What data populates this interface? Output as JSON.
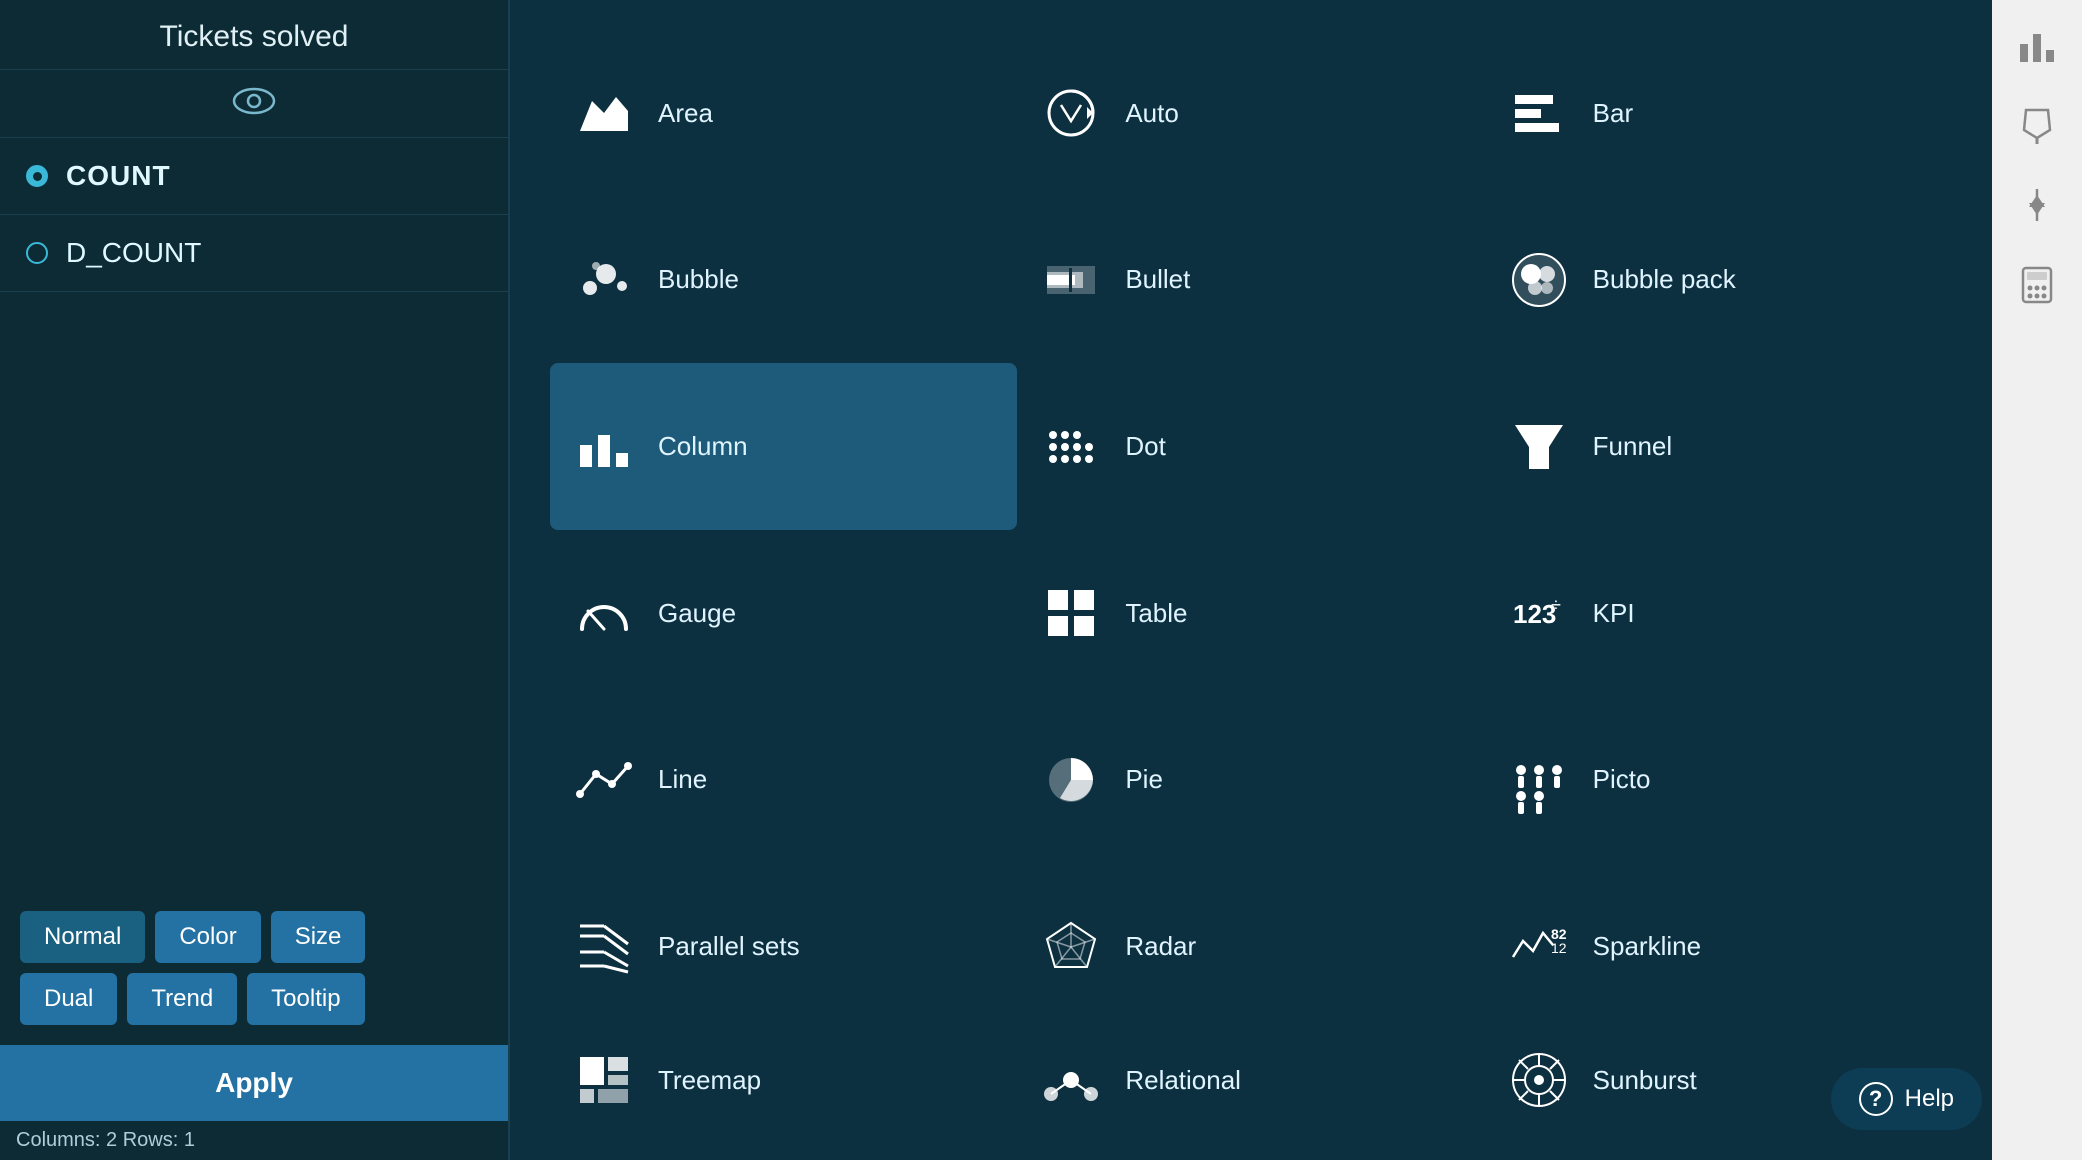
{
  "left": {
    "title": "Tickets solved",
    "count_label": "COUNT",
    "dcount_label": "D_COUNT",
    "buttons_row1": [
      "Normal",
      "Color",
      "Size"
    ],
    "buttons_row2": [
      "Dual",
      "Trend",
      "Tooltip"
    ],
    "apply_label": "Apply",
    "status": "Columns: 2    Rows: 1"
  },
  "charts": [
    {
      "id": "area",
      "label": "Area",
      "selected": false
    },
    {
      "id": "auto",
      "label": "Auto",
      "selected": false
    },
    {
      "id": "bar",
      "label": "Bar",
      "selected": false
    },
    {
      "id": "bubble",
      "label": "Bubble",
      "selected": false
    },
    {
      "id": "bullet",
      "label": "Bullet",
      "selected": false
    },
    {
      "id": "bubble-pack",
      "label": "Bubble pack",
      "selected": false
    },
    {
      "id": "column",
      "label": "Column",
      "selected": true
    },
    {
      "id": "dot",
      "label": "Dot",
      "selected": false
    },
    {
      "id": "funnel",
      "label": "Funnel",
      "selected": false
    },
    {
      "id": "gauge",
      "label": "Gauge",
      "selected": false
    },
    {
      "id": "table",
      "label": "Table",
      "selected": false
    },
    {
      "id": "kpi",
      "label": "KPI",
      "selected": false
    },
    {
      "id": "line",
      "label": "Line",
      "selected": false
    },
    {
      "id": "pie",
      "label": "Pie",
      "selected": false
    },
    {
      "id": "picto",
      "label": "Picto",
      "selected": false
    },
    {
      "id": "parallel-sets",
      "label": "Parallel sets",
      "selected": false
    },
    {
      "id": "radar",
      "label": "Radar",
      "selected": false
    },
    {
      "id": "sparkline",
      "label": "Sparkline",
      "selected": false
    },
    {
      "id": "treemap",
      "label": "Treemap",
      "selected": false
    },
    {
      "id": "relational",
      "label": "Relational",
      "selected": false
    },
    {
      "id": "sunburst",
      "label": "Sunburst",
      "selected": false
    }
  ],
  "help_label": "Help",
  "sidebar": {
    "bar_icon": "bar-chart-icon",
    "brush_icon": "brush-icon",
    "sort_icon": "sort-icon",
    "calc_icon": "calculator-icon"
  }
}
